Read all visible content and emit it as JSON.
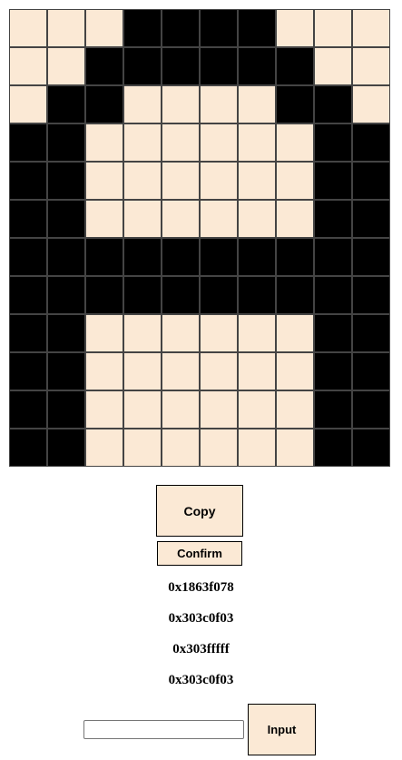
{
  "grid": {
    "cols": 10,
    "rows": 12,
    "on_color": "#000000",
    "off_color": "#fbe9d5",
    "cells": [
      "0001111000",
      "0011111100",
      "0110000110",
      "1100000011",
      "1100000011",
      "1100000011",
      "1111111111",
      "1111111111",
      "1100000011",
      "1100000011",
      "1100000011",
      "1100000011"
    ]
  },
  "buttons": {
    "copy_label": "Copy",
    "confirm_label": "Confirm",
    "input_label": "Input"
  },
  "hex_values": [
    "0x1863f078",
    "0x303c0f03",
    "0x303fffff",
    "0x303c0f03"
  ],
  "text_input": {
    "value": "",
    "placeholder": ""
  }
}
